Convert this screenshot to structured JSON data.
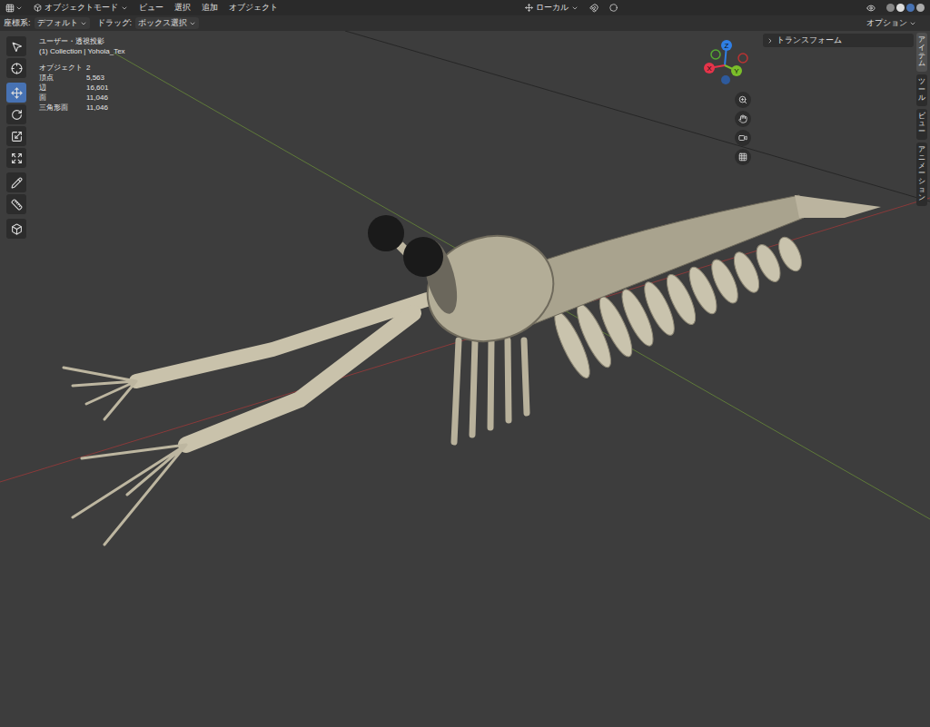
{
  "header": {
    "mode": "オブジェクトモード",
    "menus": [
      "ビュー",
      "選択",
      "追加",
      "オブジェクト"
    ],
    "orientation": "ローカル"
  },
  "tool_settings": {
    "coord_label": "座標系:",
    "coord_value": "デフォルト",
    "drag_label": "ドラッグ:",
    "drag_value": "ボックス選択",
    "options": "オプション"
  },
  "toolbar": [
    {
      "kind": "select",
      "selected": false
    },
    {
      "kind": "cursor",
      "selected": false
    },
    {
      "kind": "move",
      "selected": true
    },
    {
      "kind": "rotate",
      "selected": false
    },
    {
      "kind": "scale",
      "selected": false
    },
    {
      "kind": "transform",
      "selected": false
    },
    {
      "kind": "annotate",
      "selected": false
    },
    {
      "kind": "measure",
      "selected": false
    },
    {
      "kind": "add",
      "selected": false
    }
  ],
  "viewport": {
    "view": "ユーザー・透視投影",
    "collection": "(1) Collection | Yohoia_Tex",
    "stats": [
      {
        "label": "オブジェクト",
        "value": "2"
      },
      {
        "label": "頂点",
        "value": "5,563"
      },
      {
        "label": "辺",
        "value": "16,601"
      },
      {
        "label": "面",
        "value": "11,046"
      },
      {
        "label": "三角形面",
        "value": "11,046"
      }
    ]
  },
  "gizmo": {
    "axes": [
      {
        "label": "Z",
        "color": "#2f7fe6"
      },
      {
        "label": "X",
        "color": "#e6344a"
      },
      {
        "label": "Y",
        "color": "#7bbf2a"
      }
    ]
  },
  "sidebar": {
    "panel": "トランスフォーム",
    "expanded": false,
    "tabs": [
      {
        "label": "アイテム",
        "selected": true
      },
      {
        "label": "ツール",
        "selected": false
      },
      {
        "label": "ビュー",
        "selected": false
      },
      {
        "label": "アニメーション",
        "selected": false
      }
    ]
  }
}
